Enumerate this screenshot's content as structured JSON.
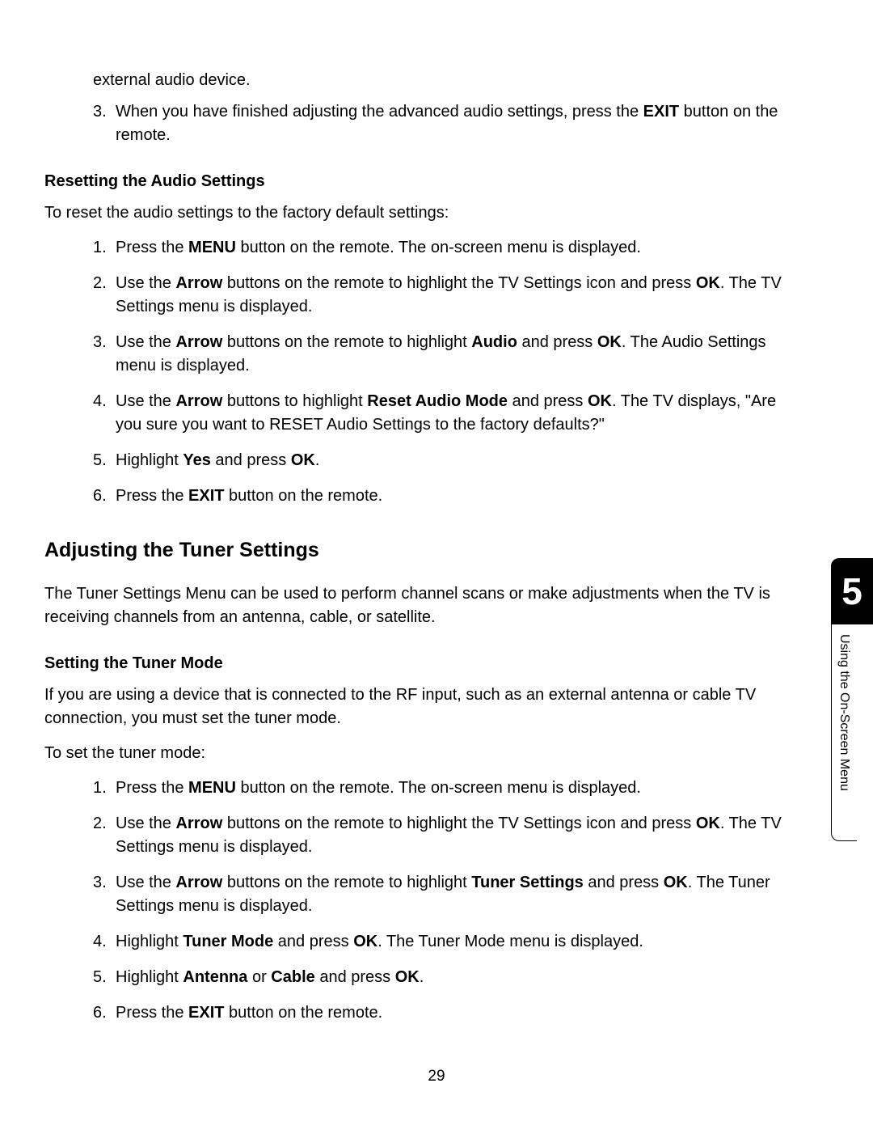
{
  "continuation": "external audio device.",
  "topList": {
    "item3": {
      "num": "3.",
      "pre": "When you have finished adjusting the advanced audio settings, press the ",
      "bold1": "EXIT",
      "post": " button on the remote."
    }
  },
  "resetting": {
    "heading": "Resetting the Audio Settings",
    "intro": "To reset the audio settings to the factory default settings:",
    "items": {
      "1": {
        "num": "1.",
        "t0": "Press the ",
        "b0": "MENU",
        "t1": " button on the remote. The on-screen menu is displayed."
      },
      "2": {
        "num": "2.",
        "t0": "Use the ",
        "b0": "Arrow",
        "t1": " buttons on the remote to highlight the TV Settings icon and press ",
        "b1": "OK",
        "t2": ". The TV Settings menu is displayed."
      },
      "3": {
        "num": "3.",
        "t0": "Use the ",
        "b0": "Arrow",
        "t1": " buttons on the remote to highlight ",
        "b1": "Audio",
        "t2": " and press ",
        "b2": "OK",
        "t3": ". The Audio Settings menu is displayed."
      },
      "4": {
        "num": "4.",
        "t0": "Use the ",
        "b0": "Arrow",
        "t1": " buttons to highlight ",
        "b1": "Reset Audio Mode",
        "t2": " and press ",
        "b2": "OK",
        "t3": ". The TV displays, \"Are you sure you want to RESET Audio Settings to the factory defaults?\""
      },
      "5": {
        "num": "5.",
        "t0": "Highlight ",
        "b0": "Yes",
        "t1": " and press ",
        "b1": "OK",
        "t2": "."
      },
      "6": {
        "num": "6.",
        "t0": "Press the ",
        "b0": "EXIT",
        "t1": " button on the remote."
      }
    }
  },
  "tuner": {
    "heading": "Adjusting the Tuner Settings",
    "intro": "The Tuner Settings Menu can be used to perform channel scans or make adjustments when the TV is receiving channels from an antenna, cable, or satellite.",
    "subheading": "Setting the Tuner Mode",
    "description": "If you are using a device that is connected to the RF input, such as an external antenna or cable TV connection, you must set the tuner mode.",
    "lead": "To set the tuner mode:",
    "items": {
      "1": {
        "num": "1.",
        "t0": "Press the ",
        "b0": "MENU",
        "t1": " button on the remote. The on-screen menu is displayed."
      },
      "2": {
        "num": "2.",
        "t0": "Use the ",
        "b0": "Arrow",
        "t1": " buttons on the remote to highlight the TV Settings icon and press ",
        "b1": "OK",
        "t2": ". The TV Settings menu is displayed."
      },
      "3": {
        "num": "3.",
        "t0": "Use the ",
        "b0": "Arrow",
        "t1": " buttons on the remote to highlight ",
        "b1": "Tuner Settings",
        "t2": " and press ",
        "b2": "OK",
        "t3": ". The Tuner Settings menu is displayed."
      },
      "4": {
        "num": "4.",
        "t0": "Highlight ",
        "b0": "Tuner Mode",
        "t1": " and press ",
        "b1": "OK",
        "t2": ". The Tuner Mode menu is displayed."
      },
      "5": {
        "num": "5.",
        "t0": "Highlight ",
        "b0": "Antenna",
        "t1": " or ",
        "b1": "Cable",
        "t2": " and press ",
        "b2": "OK",
        "t3": "."
      },
      "6": {
        "num": "6.",
        "t0": "Press the ",
        "b0": "EXIT",
        "t1": " button on the remote."
      }
    }
  },
  "pageNumber": "29",
  "sideTab": {
    "number": "5",
    "label": "Using the On-Screen Menu"
  }
}
